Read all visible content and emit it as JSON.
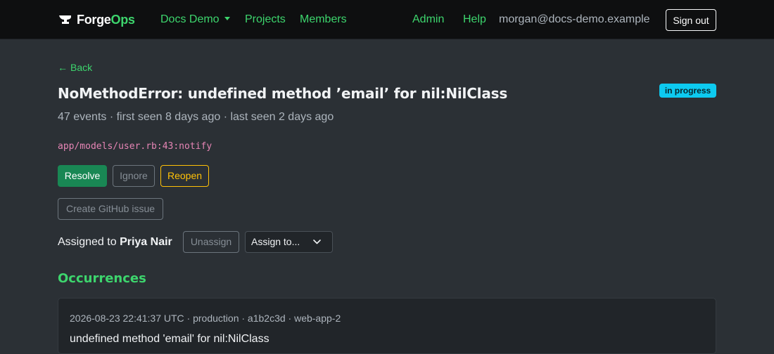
{
  "navbar": {
    "brand_part1": "Forge",
    "brand_part2": "Ops",
    "workspace": "Docs Demo",
    "links": [
      "Projects",
      "Members"
    ],
    "admin": "Admin",
    "help": "Help",
    "user_email": "morgan@docs-demo.example",
    "sign_out": "Sign out"
  },
  "issue": {
    "back": "Back",
    "title": "NoMethodError: undefined method ’email’ for nil:NilClass",
    "status": "in progress",
    "meta": "47 events · first seen 8 days ago · last seen 2 days ago",
    "location": "app/models/user.rb:43:notify"
  },
  "actions": {
    "resolve": "Resolve",
    "ignore": "Ignore",
    "reopen": "Reopen",
    "github": "Create GitHub issue"
  },
  "assignment": {
    "prefix": "Assigned to",
    "assignee": "Priya Nair",
    "unassign": "Unassign",
    "assign_to": "Assign to..."
  },
  "occurrences": {
    "heading": "Occurrences",
    "items": [
      {
        "meta": "2026-08-23 22:41:37 UTC · production · a1b2c3d · web-app-2",
        "message": "undefined method 'email' for nil:NilClass"
      }
    ]
  },
  "colors": {
    "accent": "#3dd56d",
    "navbar_bg": "#0e0f10",
    "page_bg": "#2b3035",
    "badge_bg": "#0dcaf0",
    "resolve_bg": "#198754",
    "reopen": "#ffc107",
    "code": "#e685b5"
  },
  "icons": {
    "brand": "anvil-icon",
    "workspace_caret": "caret-down-icon",
    "back": "arrow-left-icon",
    "assign_chevron": "chevron-down-icon"
  }
}
